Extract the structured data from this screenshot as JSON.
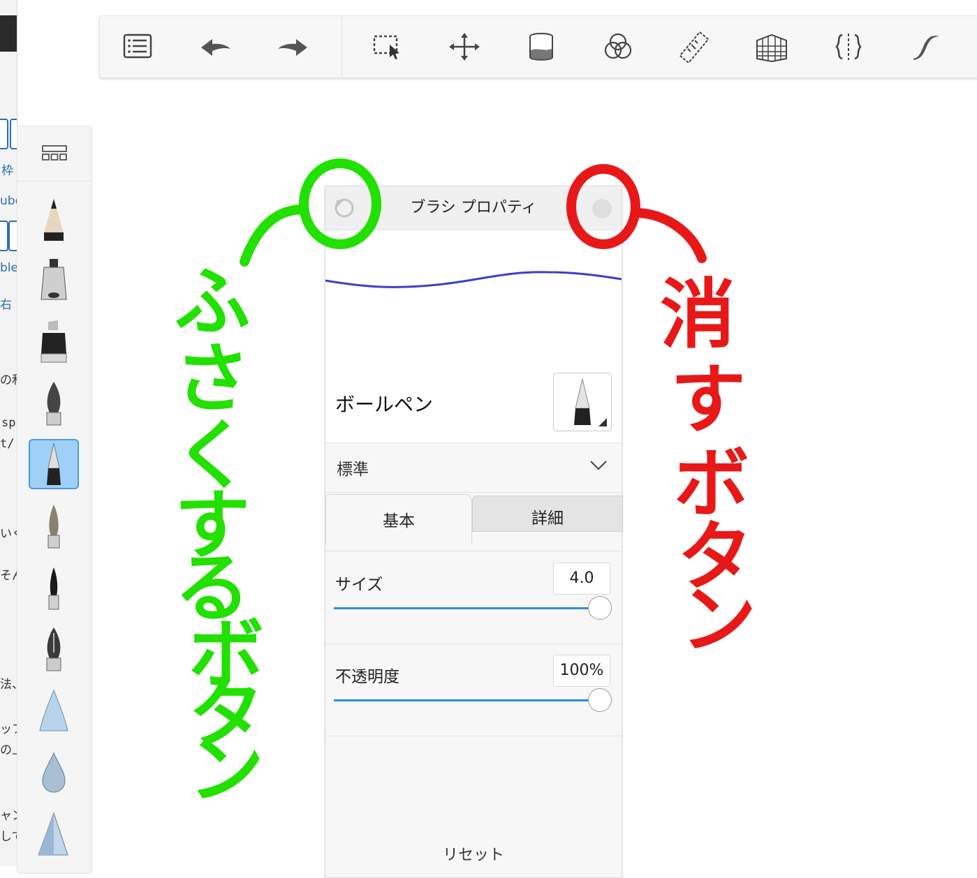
{
  "background_window": {
    "fragments": [
      "枠",
      "ube",
      "ble",
      "右",
      "の和",
      "sp",
      "t/",
      "いく",
      "そん",
      "法、",
      "ッフ",
      "の上",
      "ャン",
      "して"
    ]
  },
  "toolbar": {
    "buttons": [
      {
        "name": "layers-list-icon"
      },
      {
        "name": "undo-icon"
      },
      {
        "name": "redo-icon"
      },
      {
        "name": "selection-icon"
      },
      {
        "name": "transform-icon"
      },
      {
        "name": "fill-bucket-icon"
      },
      {
        "name": "color-circles-icon"
      },
      {
        "name": "ruler-icon"
      },
      {
        "name": "perspective-icon"
      },
      {
        "name": "symmetry-icon"
      },
      {
        "name": "curve-icon"
      }
    ]
  },
  "brush_panel": {
    "selected_index": 4,
    "brushes": [
      "pencil",
      "marker",
      "chisel-marker",
      "fountain-pen",
      "ballpoint-pen",
      "paint-brush",
      "ink-brush",
      "nib-pen",
      "airbrush-cone",
      "water-drop",
      "triangle-brush"
    ]
  },
  "dialog": {
    "title": "ブラシ プロパティ",
    "brush_name": "ボールペン",
    "preset": "標準",
    "tabs": {
      "basic": "基本",
      "detail": "詳細"
    },
    "size": {
      "label": "サイズ",
      "value": "4.0",
      "level": 1.0
    },
    "opacity": {
      "label": "不透明度",
      "value": "100%",
      "level": 1.0
    },
    "reset": "リセット",
    "stroke_color": "#3a3fc8"
  },
  "annotations": {
    "minimize_label": "ふさくするボタン",
    "close_label": "消すボタン",
    "green": "#22e000",
    "red": "#e81818"
  }
}
